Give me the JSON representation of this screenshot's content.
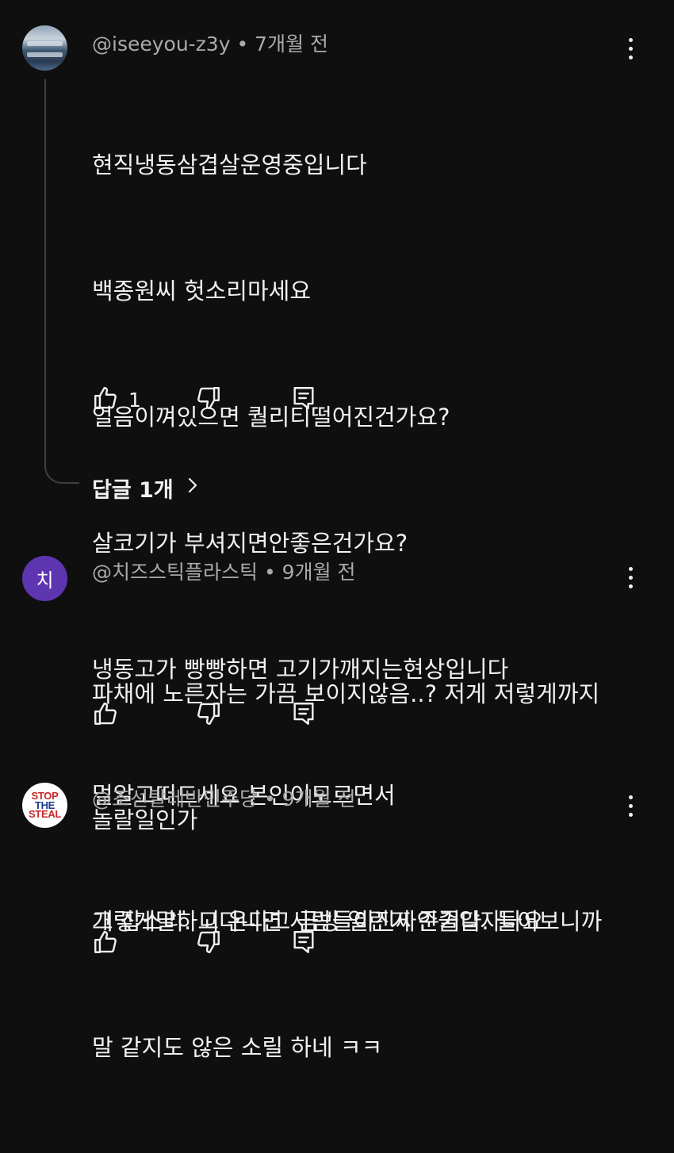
{
  "comments": [
    {
      "author": "@iseeyou-z3y",
      "time": "7개월 전",
      "avatar": "photo",
      "lines": [
        "현직냉동삼겹살운영중입니다",
        "백종원씨 헛소리마세요",
        "얼음이껴있으면 퀄리티떨어진건가요?",
        "살코기가 부셔지면안좋은건가요?",
        "냉동고가 빵빵하면 고기가깨지는현상입니다",
        "멀알고떠드세요 본인이모르면서",
        "그렇게말하고다니면 사람들이진짜인줄알자나요"
      ],
      "likes": "1",
      "replies_label": "답글 1개"
    },
    {
      "author": "@치즈스틱플라스틱",
      "time": "9개월 전",
      "avatar_letter": "치",
      "avatar_color": "#5e35b1",
      "lines": [
        "파채에 노른자는 가끔 보이지않음..? 저게 저렇게까지",
        "놀랄일인가"
      ],
      "likes": ""
    },
    {
      "author": "@조선탈레반민주당",
      "time": "9개월 전",
      "avatar_text": [
        "STOP",
        "THE",
        "STEAL"
      ],
      "lines": [
        "개 잡소리. 니 온다고 금방 열린거 준거다. 들어보니까",
        "말 같지도 않은 소릴 하네 ㅋㅋ"
      ],
      "likes": ""
    }
  ],
  "separator": "•",
  "icons": [
    "like-icon",
    "dislike-icon",
    "reply-icon",
    "more-vert-icon",
    "chevron-right-icon"
  ],
  "colors": {
    "background": "#0f0f0f",
    "text": "#f1f1f1",
    "meta": "#aaaaaa",
    "avatar_purple": "#5e35b1"
  }
}
